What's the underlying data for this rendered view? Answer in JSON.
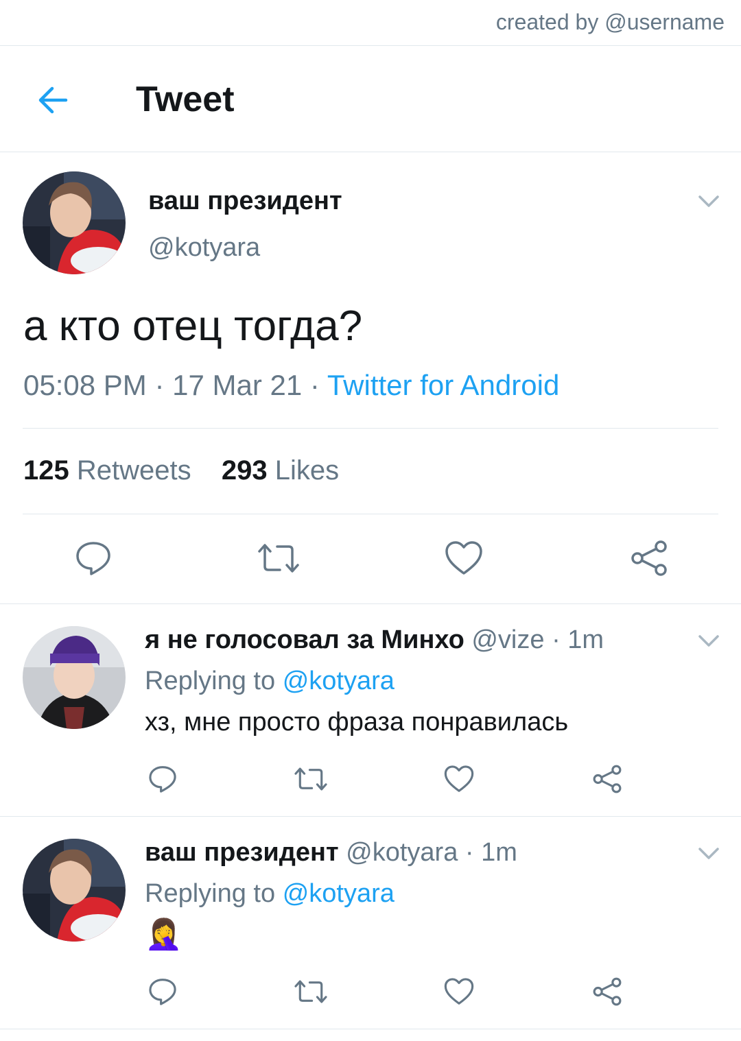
{
  "credit": "created by @username",
  "header": {
    "title": "Tweet"
  },
  "main_tweet": {
    "display_name": "ваш президент",
    "handle": "@kotyara",
    "text": "а кто отец тогда?",
    "time": "05:08 PM",
    "date": "17 Mar 21",
    "sep": "·",
    "source": "Twitter for Android",
    "retweets_count": "125",
    "retweets_label": "Retweets",
    "likes_count": "293",
    "likes_label": "Likes"
  },
  "replies": [
    {
      "display_name": "я не голосовал за Минхо",
      "handle": "@vize",
      "sep": "·",
      "time": "1m",
      "replying_label": "Replying to",
      "replying_to": "@kotyara",
      "text": "хз, мне просто фраза понравилась"
    },
    {
      "display_name": "ваш президент",
      "handle": "@kotyara",
      "sep": "·",
      "time": "1m",
      "replying_label": "Replying to",
      "replying_to": "@kotyara",
      "text": "🤦‍♀️"
    }
  ],
  "icons": {
    "back": "arrow-left-icon",
    "more": "chevron-down-icon",
    "reply": "reply-icon",
    "retweet": "retweet-icon",
    "like": "heart-icon",
    "share": "share-icon"
  },
  "colors": {
    "accent": "#1da1f2",
    "muted": "#657786",
    "text": "#14171a",
    "divider": "#e1e8ed"
  }
}
